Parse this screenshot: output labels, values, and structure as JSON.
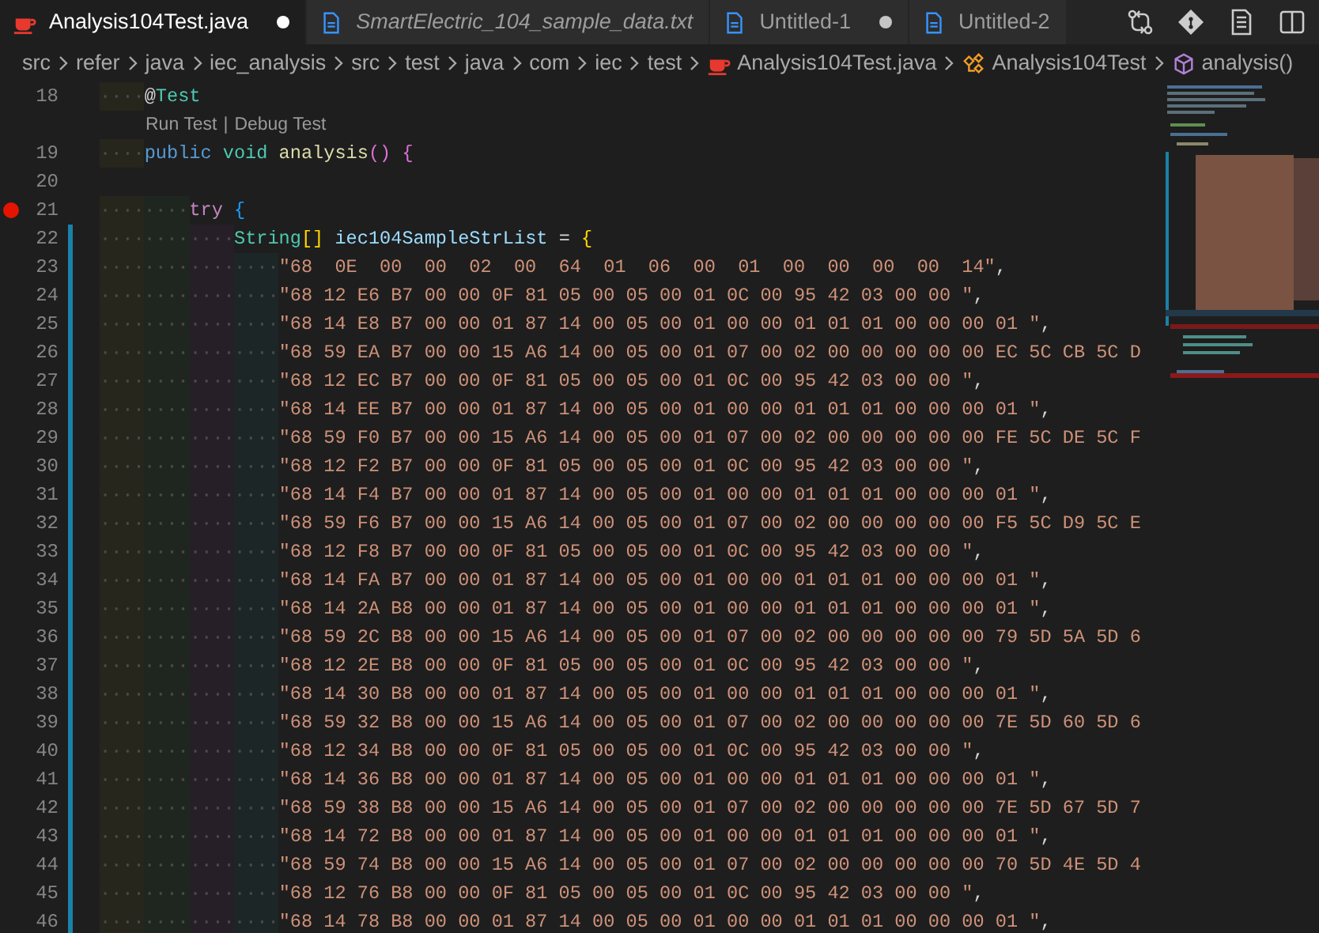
{
  "tabs": [
    {
      "label": "Analysis104Test.java",
      "kind": "java",
      "selected": true,
      "dirty": true,
      "preview": false
    },
    {
      "label": "SmartElectric_104_sample_data.txt",
      "kind": "file",
      "selected": false,
      "dirty": false,
      "preview": true
    },
    {
      "label": "Untitled-1",
      "kind": "file",
      "selected": false,
      "dirty": true,
      "preview": false
    },
    {
      "label": "Untitled-2",
      "kind": "file",
      "selected": false,
      "dirty": false,
      "preview": false
    }
  ],
  "breadcrumbs": [
    {
      "label": "src"
    },
    {
      "label": "refer"
    },
    {
      "label": "java"
    },
    {
      "label": "iec_analysis"
    },
    {
      "label": "src"
    },
    {
      "label": "test"
    },
    {
      "label": "java"
    },
    {
      "label": "com"
    },
    {
      "label": "iec"
    },
    {
      "label": "test"
    },
    {
      "label": "Analysis104Test.java",
      "kind": "java"
    },
    {
      "label": "Analysis104Test",
      "kind": "class"
    },
    {
      "label": "analysis()",
      "kind": "method"
    }
  ],
  "editor": {
    "rows": [
      {
        "kind": "code",
        "number": "18",
        "breakpoint": false,
        "modified": false,
        "tokens": [
          {
            "text": "    @",
            "kind": "plain"
          },
          {
            "text": "Test",
            "kind": "type"
          }
        ]
      },
      {
        "kind": "codelens",
        "links": [
          "Run Test",
          "Debug Test"
        ],
        "separator": "|"
      },
      {
        "kind": "code",
        "number": "19",
        "breakpoint": false,
        "modified": false,
        "tokens": [
          {
            "text": "    public ",
            "kind": "keyword"
          },
          {
            "text": "void ",
            "kind": "type"
          },
          {
            "text": "analysis",
            "kind": "function"
          },
          {
            "text": "()",
            "kind": "bracket",
            "color": "#da70d6"
          },
          {
            "text": " {",
            "kind": "bracket",
            "color": "#da70d6"
          }
        ]
      },
      {
        "kind": "code",
        "number": "20",
        "breakpoint": false,
        "modified": false
      },
      {
        "kind": "code",
        "number": "21",
        "breakpoint": true,
        "modified": false,
        "tokens": [
          {
            "text": "        try",
            "kind": "control"
          },
          {
            "text": " {",
            "kind": "bracket",
            "color": "#179fff"
          }
        ]
      },
      {
        "kind": "code",
        "number": "22",
        "breakpoint": false,
        "modified": true,
        "tokens": [
          {
            "text": "            String",
            "kind": "type"
          },
          {
            "text": "[]",
            "kind": "bracket",
            "color": "#ffd700"
          },
          {
            "text": " iec104SampleStrList",
            "kind": "variable"
          },
          {
            "text": " = ",
            "kind": "plain"
          },
          {
            "text": "{",
            "kind": "bracket",
            "color": "#ffd700"
          }
        ]
      },
      {
        "kind": "code",
        "number": "23",
        "breakpoint": false,
        "modified": true,
        "tokens": [
          {
            "text": "                \"68  0E  00  00  02  00  64  01  06  00  01  00  00  00  00  14\"",
            "kind": "string"
          },
          {
            "text": ",",
            "kind": "plain"
          }
        ]
      },
      {
        "kind": "code",
        "number": "24",
        "breakpoint": false,
        "modified": true,
        "tokens": [
          {
            "text": "                \"68 12 E6 B7 00 00 0F 81 05 00 05 00 01 0C 00 95 42 03 00 00 \"",
            "kind": "string"
          },
          {
            "text": ",",
            "kind": "plain"
          }
        ]
      },
      {
        "kind": "code",
        "number": "25",
        "breakpoint": false,
        "modified": true,
        "tokens": [
          {
            "text": "                \"68 14 E8 B7 00 00 01 87 14 00 05 00 01 00 00 01 01 01 00 00 00 01 \"",
            "kind": "string"
          },
          {
            "text": ",",
            "kind": "plain"
          }
        ]
      },
      {
        "kind": "code",
        "number": "26",
        "breakpoint": false,
        "modified": true,
        "tokens": [
          {
            "text": "                \"68 59 EA B7 00 00 15 A6 14 00 05 00 01 07 00 02 00 00 00 00 00 EC 5C CB 5C D",
            "kind": "string"
          }
        ]
      },
      {
        "kind": "code",
        "number": "27",
        "breakpoint": false,
        "modified": true,
        "tokens": [
          {
            "text": "                \"68 12 EC B7 00 00 0F 81 05 00 05 00 01 0C 00 95 42 03 00 00 \"",
            "kind": "string"
          },
          {
            "text": ",",
            "kind": "plain"
          }
        ]
      },
      {
        "kind": "code",
        "number": "28",
        "breakpoint": false,
        "modified": true,
        "tokens": [
          {
            "text": "                \"68 14 EE B7 00 00 01 87 14 00 05 00 01 00 00 01 01 01 00 00 00 01 \"",
            "kind": "string"
          },
          {
            "text": ",",
            "kind": "plain"
          }
        ]
      },
      {
        "kind": "code",
        "number": "29",
        "breakpoint": false,
        "modified": true,
        "tokens": [
          {
            "text": "                \"68 59 F0 B7 00 00 15 A6 14 00 05 00 01 07 00 02 00 00 00 00 00 FE 5C DE 5C F",
            "kind": "string"
          }
        ]
      },
      {
        "kind": "code",
        "number": "30",
        "breakpoint": false,
        "modified": true,
        "tokens": [
          {
            "text": "                \"68 12 F2 B7 00 00 0F 81 05 00 05 00 01 0C 00 95 42 03 00 00 \"",
            "kind": "string"
          },
          {
            "text": ",",
            "kind": "plain"
          }
        ]
      },
      {
        "kind": "code",
        "number": "31",
        "breakpoint": false,
        "modified": true,
        "tokens": [
          {
            "text": "                \"68 14 F4 B7 00 00 01 87 14 00 05 00 01 00 00 01 01 01 00 00 00 01 \"",
            "kind": "string"
          },
          {
            "text": ",",
            "kind": "plain"
          }
        ]
      },
      {
        "kind": "code",
        "number": "32",
        "breakpoint": false,
        "modified": true,
        "tokens": [
          {
            "text": "                \"68 59 F6 B7 00 00 15 A6 14 00 05 00 01 07 00 02 00 00 00 00 00 F5 5C D9 5C E",
            "kind": "string"
          }
        ]
      },
      {
        "kind": "code",
        "number": "33",
        "breakpoint": false,
        "modified": true,
        "tokens": [
          {
            "text": "                \"68 12 F8 B7 00 00 0F 81 05 00 05 00 01 0C 00 95 42 03 00 00 \"",
            "kind": "string"
          },
          {
            "text": ",",
            "kind": "plain"
          }
        ]
      },
      {
        "kind": "code",
        "number": "34",
        "breakpoint": false,
        "modified": true,
        "tokens": [
          {
            "text": "                \"68 14 FA B7 00 00 01 87 14 00 05 00 01 00 00 01 01 01 00 00 00 01 \"",
            "kind": "string"
          },
          {
            "text": ",",
            "kind": "plain"
          }
        ]
      },
      {
        "kind": "code",
        "number": "35",
        "breakpoint": false,
        "modified": true,
        "tokens": [
          {
            "text": "                \"68 14 2A B8 00 00 01 87 14 00 05 00 01 00 00 01 01 01 00 00 00 01 \"",
            "kind": "string"
          },
          {
            "text": ",",
            "kind": "plain"
          }
        ]
      },
      {
        "kind": "code",
        "number": "36",
        "breakpoint": false,
        "modified": true,
        "tokens": [
          {
            "text": "                \"68 59 2C B8 00 00 15 A6 14 00 05 00 01 07 00 02 00 00 00 00 00 79 5D 5A 5D 6",
            "kind": "string"
          }
        ]
      },
      {
        "kind": "code",
        "number": "37",
        "breakpoint": false,
        "modified": true,
        "tokens": [
          {
            "text": "                \"68 12 2E B8 00 00 0F 81 05 00 05 00 01 0C 00 95 42 03 00 00 \"",
            "kind": "string"
          },
          {
            "text": ",",
            "kind": "plain"
          }
        ]
      },
      {
        "kind": "code",
        "number": "38",
        "breakpoint": false,
        "modified": true,
        "tokens": [
          {
            "text": "                \"68 14 30 B8 00 00 01 87 14 00 05 00 01 00 00 01 01 01 00 00 00 01 \"",
            "kind": "string"
          },
          {
            "text": ",",
            "kind": "plain"
          }
        ]
      },
      {
        "kind": "code",
        "number": "39",
        "breakpoint": false,
        "modified": true,
        "tokens": [
          {
            "text": "                \"68 59 32 B8 00 00 15 A6 14 00 05 00 01 07 00 02 00 00 00 00 00 7E 5D 60 5D 6",
            "kind": "string"
          }
        ]
      },
      {
        "kind": "code",
        "number": "40",
        "breakpoint": false,
        "modified": true,
        "tokens": [
          {
            "text": "                \"68 12 34 B8 00 00 0F 81 05 00 05 00 01 0C 00 95 42 03 00 00 \"",
            "kind": "string"
          },
          {
            "text": ",",
            "kind": "plain"
          }
        ]
      },
      {
        "kind": "code",
        "number": "41",
        "breakpoint": false,
        "modified": true,
        "tokens": [
          {
            "text": "                \"68 14 36 B8 00 00 01 87 14 00 05 00 01 00 00 01 01 01 00 00 00 01 \"",
            "kind": "string"
          },
          {
            "text": ",",
            "kind": "plain"
          }
        ]
      },
      {
        "kind": "code",
        "number": "42",
        "breakpoint": false,
        "modified": true,
        "tokens": [
          {
            "text": "                \"68 59 38 B8 00 00 15 A6 14 00 05 00 01 07 00 02 00 00 00 00 00 7E 5D 67 5D 7",
            "kind": "string"
          }
        ]
      },
      {
        "kind": "code",
        "number": "43",
        "breakpoint": false,
        "modified": true,
        "tokens": [
          {
            "text": "                \"68 14 72 B8 00 00 01 87 14 00 05 00 01 00 00 01 01 01 00 00 00 01 \"",
            "kind": "string"
          },
          {
            "text": ",",
            "kind": "plain"
          }
        ]
      },
      {
        "kind": "code",
        "number": "44",
        "breakpoint": false,
        "modified": true,
        "tokens": [
          {
            "text": "                \"68 59 74 B8 00 00 15 A6 14 00 05 00 01 07 00 02 00 00 00 00 00 70 5D 4E 5D 4",
            "kind": "string"
          }
        ]
      },
      {
        "kind": "code",
        "number": "45",
        "breakpoint": false,
        "modified": true,
        "tokens": [
          {
            "text": "                \"68 12 76 B8 00 00 0F 81 05 00 05 00 01 0C 00 95 42 03 00 00 \"",
            "kind": "string"
          },
          {
            "text": ",",
            "kind": "plain"
          }
        ]
      },
      {
        "kind": "code",
        "number": "46",
        "breakpoint": false,
        "modified": true,
        "tokens": [
          {
            "text": "                \"68 14 78 B8 00 00 01 87 14 00 05 00 01 00 00 01 01 01 00 00 00 01 \"",
            "kind": "string"
          },
          {
            "text": ",",
            "kind": "plain"
          }
        ]
      }
    ]
  }
}
